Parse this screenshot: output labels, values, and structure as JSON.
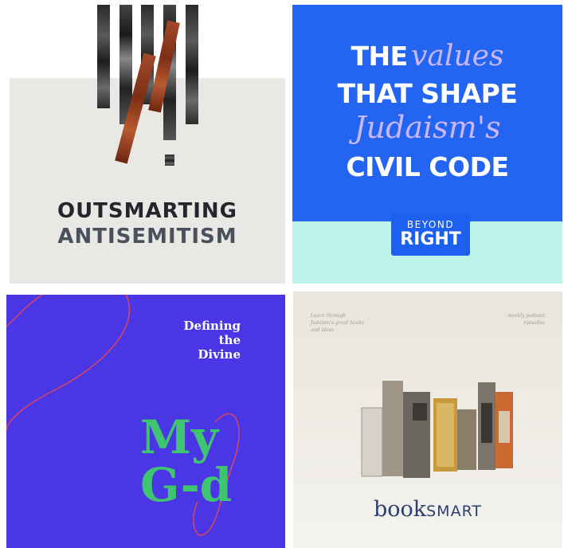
{
  "tiles": [
    {
      "id": "outsmarting-antisemitism",
      "line1": "OUTSMARTING",
      "line2": "ANTISEMITISM"
    },
    {
      "id": "beyond-right",
      "title_parts": [
        "THE",
        "values",
        "THAT SHAPE",
        "Judaism's",
        "CIVIL CODE"
      ],
      "badge_top": "BEYOND",
      "badge_bottom": "RIGHT"
    },
    {
      "id": "my-gd",
      "subtitle_lines": [
        "Defining",
        "the",
        "Divine"
      ],
      "title_lines": [
        "My",
        "G-d"
      ]
    },
    {
      "id": "book-smart",
      "corner_left": "Learn through Judaism's great books and ideas",
      "corner_right": "weekly podcast episodes",
      "brand_book": "book",
      "brand_smart": "SMART"
    }
  ],
  "colors": {
    "tile1_bg": "#e9e8e4",
    "tile2_bg": "#2364f0",
    "tile2_mint": "#bdf3ec",
    "tile3_bg": "#4b36e6",
    "tile3_green": "#3fc56f",
    "tile4_text": "#2d3f6f"
  }
}
